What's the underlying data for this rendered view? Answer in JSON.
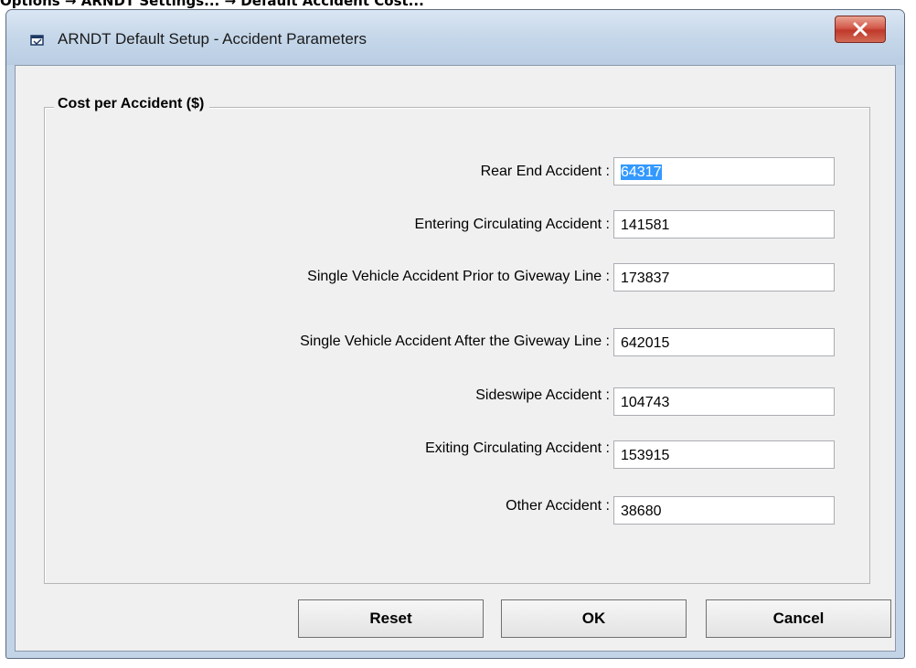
{
  "caption": "Options → ARNDT Settings... → Default Accident Cost...",
  "window": {
    "title": "ARNDT Default Setup - Accident Parameters"
  },
  "group": {
    "title": "Cost per Accident ($)"
  },
  "rows": [
    {
      "label": "Rear End Accident :",
      "value": "64317"
    },
    {
      "label": "Entering Circulating Accident :",
      "value": "141581"
    },
    {
      "label": "Single Vehicle Accident Prior to Giveway Line :",
      "value": "173837"
    },
    {
      "label": "Single Vehicle Accident After the Giveway Line :",
      "value": "642015"
    },
    {
      "label": "Sideswipe Accident :",
      "value": "104743"
    },
    {
      "label": "Exiting Circulating Accident :",
      "value": "153915"
    },
    {
      "label": "Other Accident :",
      "value": "38680"
    }
  ],
  "buttons": {
    "reset": "Reset",
    "ok": "OK",
    "cancel": "Cancel"
  },
  "colors": {
    "selection": "#3399ff",
    "close_button": "#c0392b",
    "frame": "#c3d4e7"
  },
  "icons": {
    "app": "window-app-icon",
    "close": "close-icon"
  }
}
